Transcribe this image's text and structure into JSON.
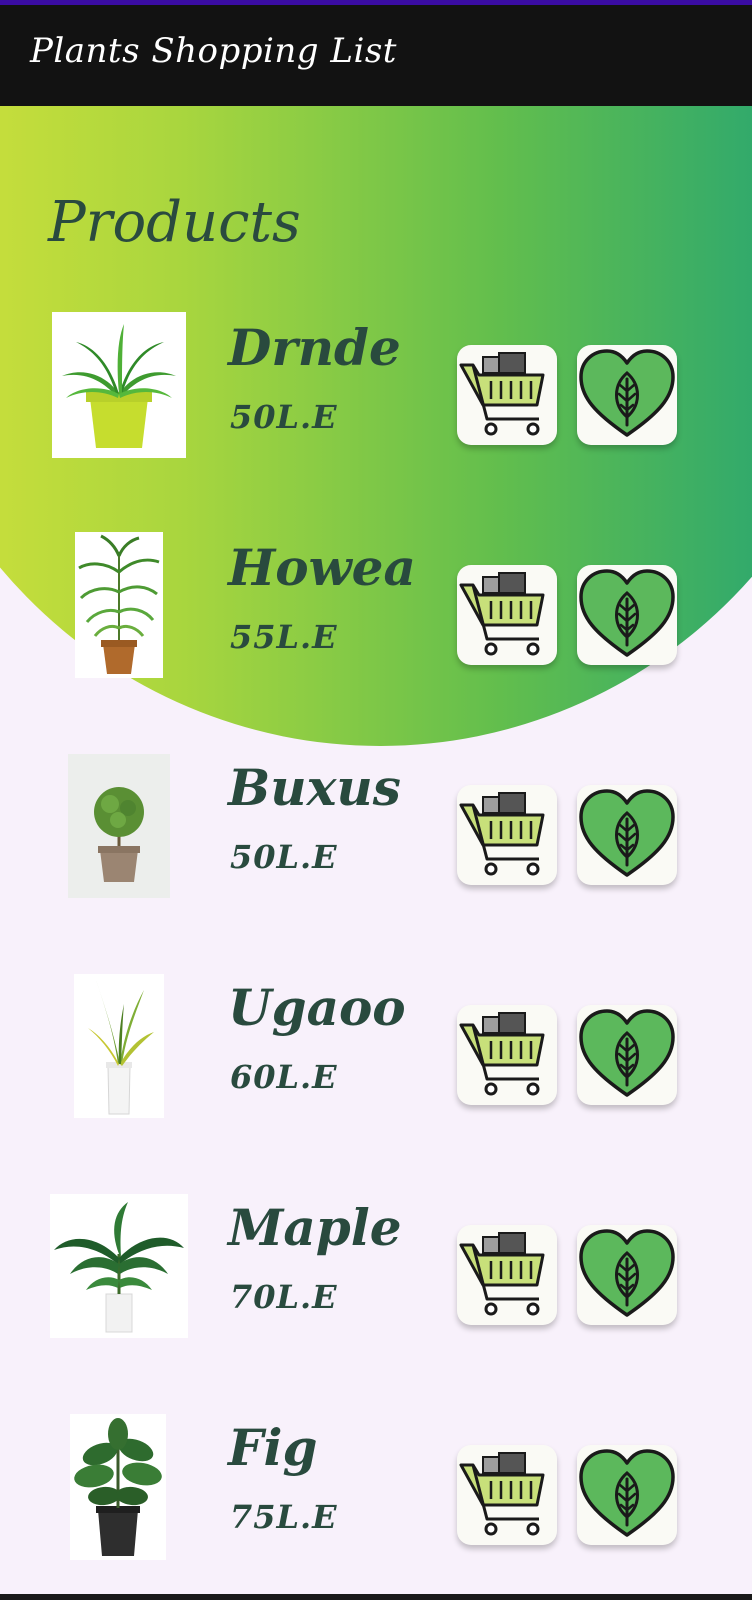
{
  "app_bar": {
    "title": "Plants Shopping List"
  },
  "main": {
    "section_title": "Products",
    "products": [
      {
        "name": "Drnde",
        "price": "50L.E"
      },
      {
        "name": "Howea",
        "price": "55L.E"
      },
      {
        "name": "Buxus",
        "price": "50L.E"
      },
      {
        "name": "Ugaoo",
        "price": "60L.E"
      },
      {
        "name": "Maple",
        "price": "70L.E"
      },
      {
        "name": "Fig",
        "price": "75L.E"
      }
    ]
  },
  "icons": {
    "cart": "shopping-cart-icon",
    "favorite": "heart-leaf-icon"
  },
  "colors": {
    "app_bar": "#121212",
    "status_strip": "#3a0ca3",
    "background": "#f8f1fb",
    "text_dark_green": "#294a3e",
    "gradient_start": "#d7e23a",
    "gradient_end": "#1aa07a",
    "heart_green": "#5cb85c",
    "cart_lime": "#c8e07a"
  }
}
